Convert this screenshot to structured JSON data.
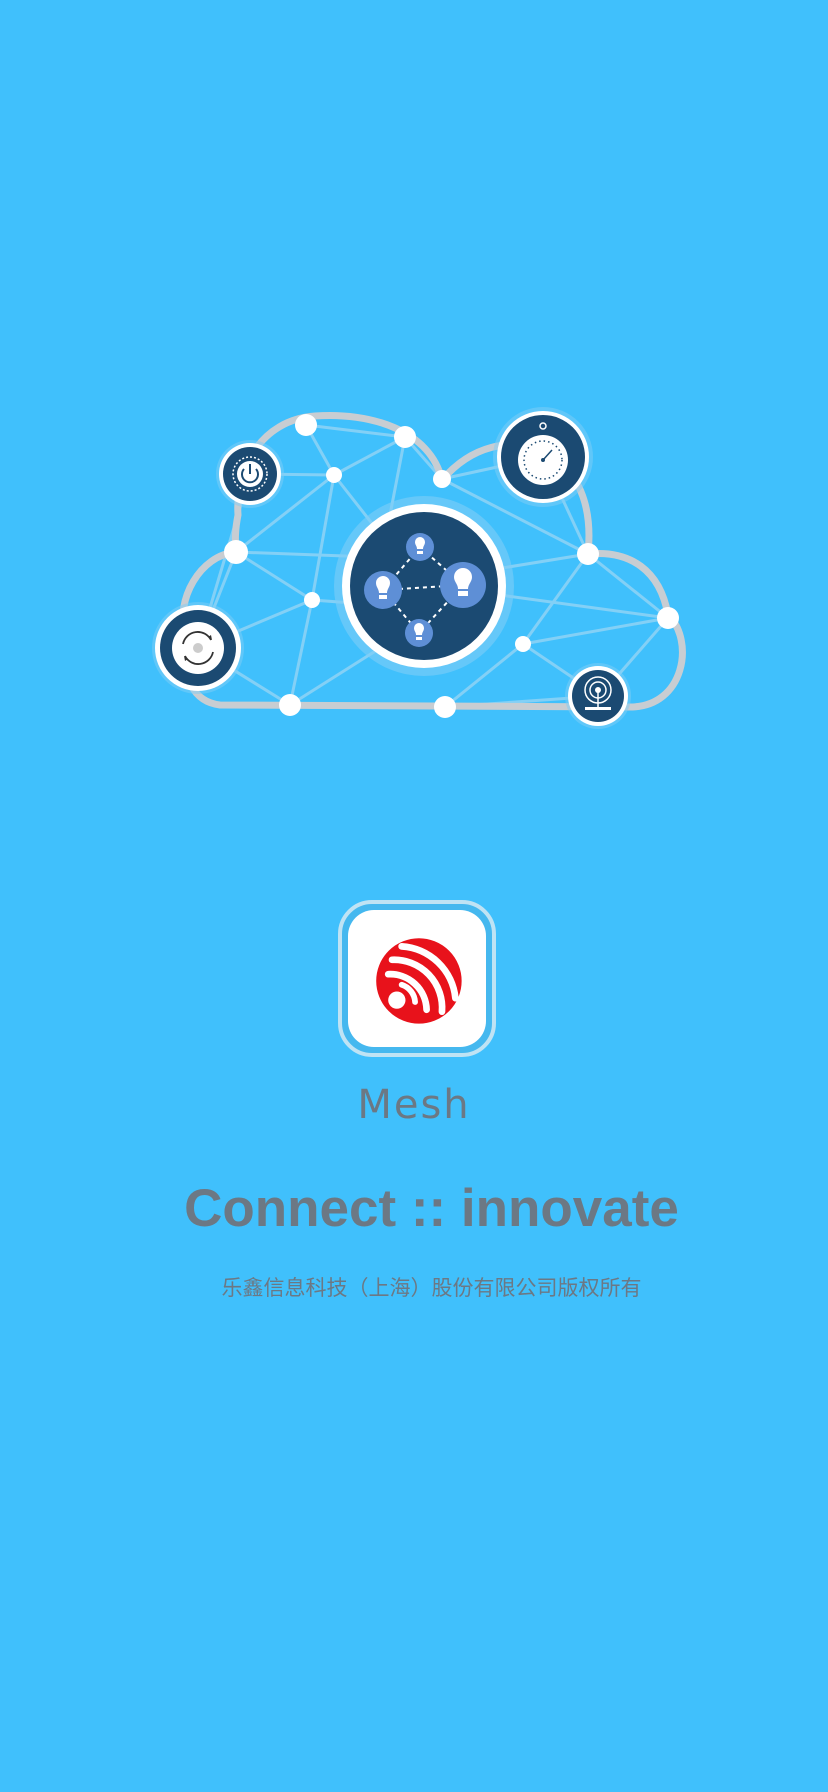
{
  "app": {
    "name": "Mesh",
    "tagline": "Connect :: innovate",
    "copyright": "乐鑫信息科技（上海）股份有限公司版权所有"
  },
  "icons": {
    "illustration": "cloud-mesh-network-illustration",
    "logo": "espressif-logo-icon",
    "power": "power-icon",
    "stopwatch": "stopwatch-icon",
    "sync": "sync-icon",
    "antenna": "antenna-icon",
    "bulb": "lightbulb-icon"
  },
  "colors": {
    "background": "#40c0fc",
    "node_dark": "#1b4a72",
    "logo_red": "#e8121b",
    "text_gray": "#6c7884"
  }
}
